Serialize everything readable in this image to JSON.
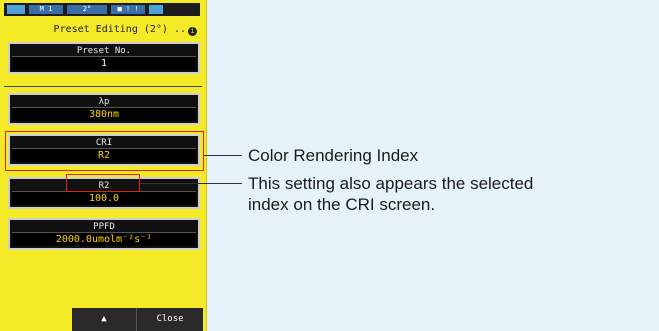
{
  "statusbar": {
    "mode": "M 1",
    "angle": "2°",
    "mem": "■ ! !"
  },
  "title": "Preset Editing (2°) ..",
  "title_info": "i",
  "preset_no": {
    "label": "Preset No.",
    "value": "1"
  },
  "lambda_p": {
    "label": "λp",
    "value": "380nm"
  },
  "cri": {
    "label": "CRI",
    "value": "R2"
  },
  "r2": {
    "label": "R2",
    "value": "100.0"
  },
  "ppfd": {
    "label": "PPFD",
    "value": "2000.0umolm⁻²s⁻¹"
  },
  "buttons": {
    "up": "▲",
    "close": "Close"
  },
  "annotations": {
    "cri": "Color Rendering Index",
    "r2_line1": "This setting also appears the selected",
    "r2_line2": "index on the CRI screen."
  },
  "colors": {
    "device": "#f4ea28",
    "highlight": "#e0201b",
    "background": "#e6f2fa"
  }
}
